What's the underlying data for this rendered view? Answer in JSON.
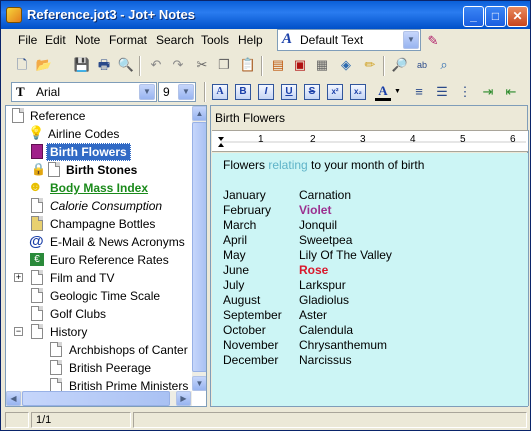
{
  "window": {
    "title": "Reference.jot3 - Jot+ Notes"
  },
  "title_buttons": {
    "minimize": "_",
    "maximize": "□",
    "close": "✕"
  },
  "menu": [
    "File",
    "Edit",
    "Note",
    "Format",
    "Search",
    "Tools",
    "Help"
  ],
  "style_combo": {
    "value": "Default Text",
    "icon": "A"
  },
  "font_combo": {
    "value": "Arial",
    "icon": "T"
  },
  "size_combo": {
    "value": "9"
  },
  "format_buttons": [
    "A",
    "B",
    "I",
    "U",
    "S",
    "x²",
    "x₂",
    "A"
  ],
  "tree": {
    "root": "Reference",
    "items": [
      {
        "label": "Airline Codes",
        "icon": "lightbulb-icon"
      },
      {
        "label": "Birth Flowers",
        "icon": "purple-doc-icon",
        "selected": true
      },
      {
        "label": "Birth Stones",
        "icon": "lock-icon",
        "bold": true
      },
      {
        "label": "Body Mass Index",
        "icon": "smiley-icon",
        "link": true
      },
      {
        "label": "Calorie Consumption",
        "icon": "doc-icon",
        "italic": true
      },
      {
        "label": "Champagne Bottles",
        "icon": "yellow-doc-icon"
      },
      {
        "label": "E-Mail & News Acronyms",
        "icon": "at-sign-icon"
      },
      {
        "label": "Euro Reference Rates",
        "icon": "euro-icon"
      },
      {
        "label": "Film and TV",
        "icon": "doc-icon",
        "expander": "+"
      },
      {
        "label": "Geologic Time Scale",
        "icon": "doc-icon"
      },
      {
        "label": "Golf Clubs",
        "icon": "doc-icon"
      },
      {
        "label": "History",
        "icon": "doc-icon",
        "expander": "−"
      },
      {
        "label": "Archbishops of Canter",
        "icon": "doc-icon",
        "child": true
      },
      {
        "label": "British Peerage",
        "icon": "doc-icon",
        "child": true
      },
      {
        "label": "British Prime Ministers",
        "icon": "doc-icon",
        "child": true
      }
    ]
  },
  "note": {
    "title": "Birth Flowers",
    "intro_a": "Flowers ",
    "intro_b": "relating",
    "intro_c": " to your month of birth",
    "rows": [
      {
        "month": "January",
        "flower": "Carnation",
        "style": ""
      },
      {
        "month": "February",
        "flower": "Violet",
        "style": "violet"
      },
      {
        "month": "March",
        "flower": "Jonquil",
        "style": ""
      },
      {
        "month": "April",
        "flower": "Sweetpea",
        "style": ""
      },
      {
        "month": "May",
        "flower": "Lily Of The Valley",
        "style": ""
      },
      {
        "month": "June",
        "flower": "Rose",
        "style": "rose"
      },
      {
        "month": "July",
        "flower": "Larkspur",
        "style": ""
      },
      {
        "month": "August",
        "flower": "Gladiolus",
        "style": ""
      },
      {
        "month": "September",
        "flower": "Aster",
        "style": ""
      },
      {
        "month": "October",
        "flower": "Calendula",
        "style": ""
      },
      {
        "month": "November",
        "flower": "Chrysanthemum",
        "style": ""
      },
      {
        "month": "December",
        "flower": "Narcissus",
        "style": ""
      }
    ],
    "colors": {
      "relating": "#5fb3c8",
      "violet": "#9b2f8f",
      "rose": "#d9172b"
    }
  },
  "ruler": {
    "ticks": [
      "1",
      "2",
      "3",
      "4",
      "5",
      "6"
    ]
  },
  "status": {
    "page": "1/1"
  }
}
